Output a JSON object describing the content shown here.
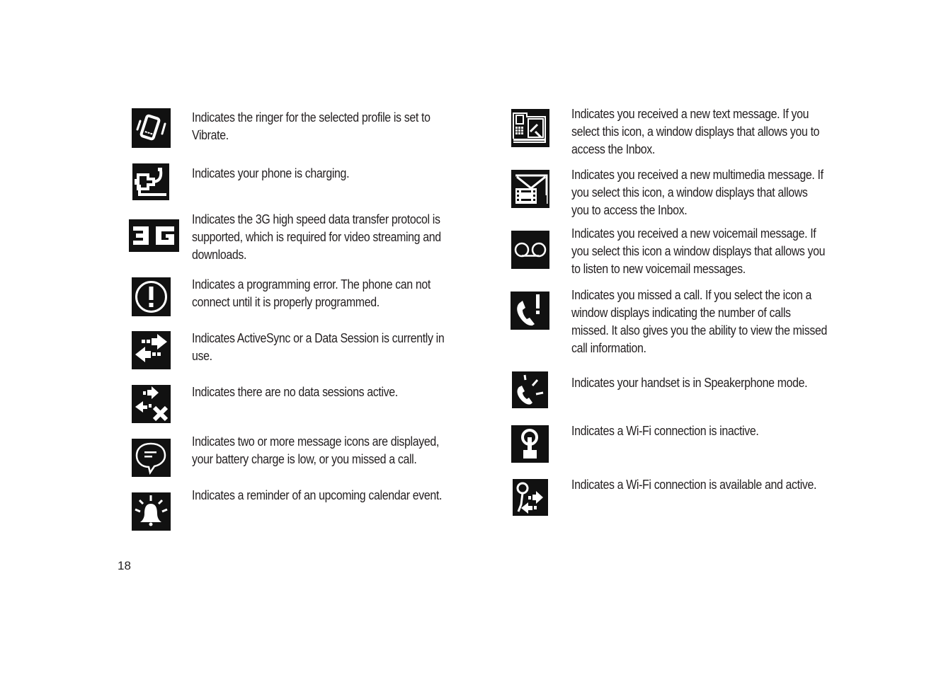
{
  "page_number": "18",
  "left_column": [
    {
      "icon": "vibrate-icon",
      "lines": [
        "Indicates the ringer for the selected profile is set to",
        "Vibrate."
      ]
    },
    {
      "icon": "charging-icon",
      "lines": [
        "Indicates your phone is charging."
      ]
    },
    {
      "icon": "3g-icon",
      "icon_text": "3G",
      "lines": [
        "Indicates the 3G high speed data transfer protocol is",
        "supported, which is required for video streaming and",
        "downloads."
      ]
    },
    {
      "icon": "programming-error-icon",
      "lines": [
        "Indicates a programming error. The phone can not",
        "connect until it is properly programmed."
      ]
    },
    {
      "icon": "data-session-active-icon",
      "lines": [
        "Indicates ActiveSync or a Data Session is currently in",
        "use."
      ]
    },
    {
      "icon": "no-data-session-icon",
      "lines": [
        "Indicates there are no data sessions active."
      ]
    },
    {
      "icon": "multiple-notifications-icon",
      "lines": [
        "Indicates two or more message icons are displayed,",
        "your battery charge is low, or you missed a call."
      ]
    },
    {
      "icon": "calendar-reminder-icon",
      "lines": [
        "Indicates a reminder of an upcoming calendar event."
      ]
    }
  ],
  "right_column": [
    {
      "icon": "new-text-message-icon",
      "lines": [
        "Indicates you received a new text message. If you",
        "select this icon, a window displays that allows you to",
        "access the Inbox."
      ]
    },
    {
      "icon": "new-multimedia-message-icon",
      "lines": [
        "Indicates you received a new multimedia message. If",
        "you select this icon, a window displays that allows",
        "you to access the Inbox."
      ]
    },
    {
      "icon": "voicemail-icon",
      "lines": [
        "Indicates you received a new voicemail message. If",
        "you select this icon a window displays that allows you",
        "to listen to new voicemail messages."
      ]
    },
    {
      "icon": "missed-call-icon",
      "lines": [
        "Indicates you missed a call. If you select the icon a",
        "window displays indicating the number of calls",
        "missed. It also gives you the ability to view the missed",
        "call information."
      ]
    },
    {
      "icon": "speakerphone-icon",
      "lines": [
        "Indicates your handset is in Speakerphone mode."
      ]
    },
    {
      "icon": "wifi-inactive-icon",
      "lines": [
        "Indicates a Wi-Fi connection is inactive."
      ]
    },
    {
      "icon": "wifi-active-icon",
      "lines": [
        "Indicates a Wi-Fi connection is available and active."
      ]
    }
  ]
}
